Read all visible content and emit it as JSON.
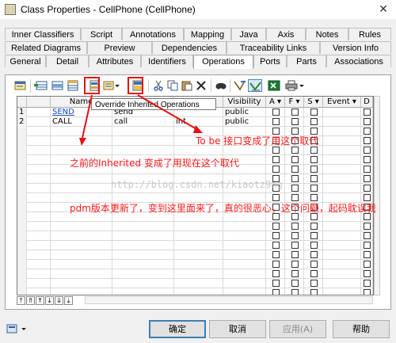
{
  "window": {
    "title": "Class Properties - CellPhone (CellPhone)",
    "close_glyph": "✕"
  },
  "tabs": {
    "row1": [
      "Inner Classifiers",
      "Script",
      "Annotations",
      "Mapping",
      "Java",
      "Axis",
      "Notes",
      "Rules"
    ],
    "row2": [
      "Related Diagrams",
      "Preview",
      "Dependencies",
      "Traceability Links",
      "Version Info"
    ],
    "row3": [
      "General",
      "Detail",
      "Attributes",
      "Identifiers",
      "Operations",
      "Ports",
      "Parts",
      "Associations"
    ],
    "active": "Operations"
  },
  "toolbar": {
    "icons": [
      "properties-icon",
      "add-row-icon",
      "insert-row-icon",
      "add-rows-icon",
      "override-inherited-icon",
      "dropdown-arrow-icon",
      "to-be-implemented-icon",
      "cut-icon",
      "copy-icon",
      "paste-icon",
      "delete-icon",
      "find-icon",
      "filter-icon",
      "customize-columns-icon",
      "excel-export-icon",
      "print-icon",
      "print-dropdown-icon"
    ],
    "tooltip": "Override Inherited Operations"
  },
  "grid": {
    "headers": [
      "Name",
      "",
      "",
      "Visibility",
      "A",
      "F",
      "S",
      "Event",
      "D"
    ],
    "rows": [
      {
        "num": "1",
        "name": "SEND",
        "code": "send",
        "type": "",
        "visibility": "public"
      },
      {
        "num": "2",
        "name": "CALL",
        "code": "call",
        "type": "int",
        "visibility": "public"
      }
    ]
  },
  "annotations": {
    "to_be": "To be 接口变成了用这个取代",
    "inherited": "之前的Inherited 变成了用现在这个取代",
    "pdm": "pdm版本更新了，变到这里面来了，真的很恶心，这个问题，起码耽误我",
    "watermark": "http://blog.csdn.net/kiaotz9ng",
    "color": "#ff1a1a"
  },
  "nav": {
    "buttons": [
      "⤒",
      "⇑",
      "↑",
      "↓",
      "⇓",
      "⤓"
    ]
  },
  "buttons": {
    "ok": "确定",
    "cancel": "取消",
    "apply": "应用(A)",
    "help": "帮助"
  }
}
